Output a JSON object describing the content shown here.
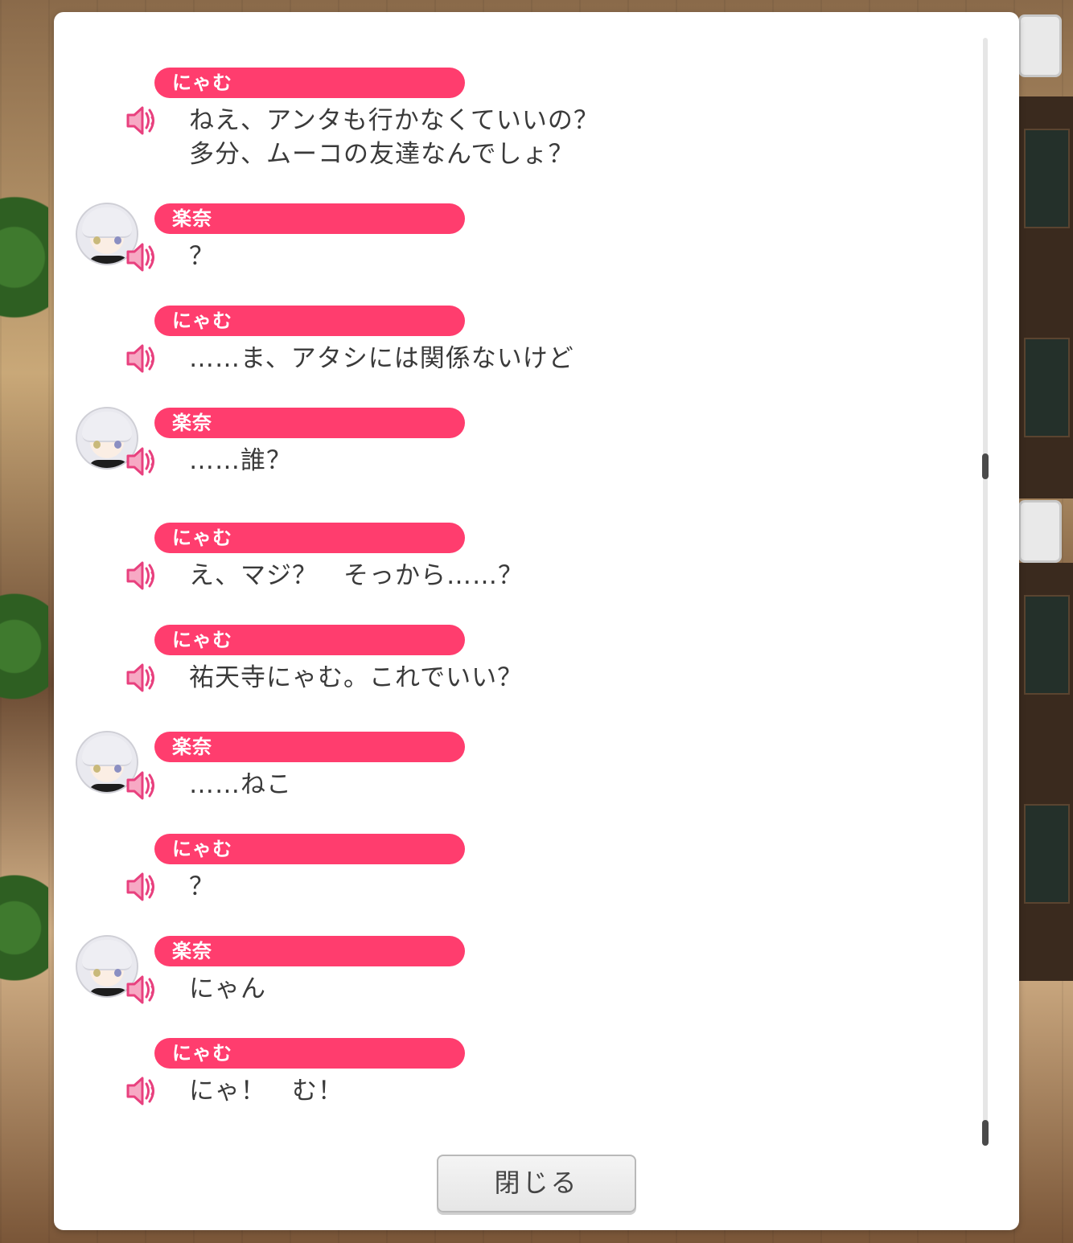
{
  "dialog": {
    "close_label": "閉じる"
  },
  "messages": [
    {
      "speaker": "にゃむ",
      "text": "ねえ、アンタも行かなくていいの？\n多分、ムーコの友達なんでしょ？",
      "avatar": false
    },
    {
      "speaker": "楽奈",
      "text": "？",
      "avatar": true
    },
    {
      "speaker": "にゃむ",
      "text": "……ま、アタシには関係ないけど",
      "avatar": false
    },
    {
      "speaker": "楽奈",
      "text": "……誰？",
      "avatar": true
    },
    {
      "speaker": "にゃむ",
      "text": "え、マジ？　そっから……？",
      "avatar": false
    },
    {
      "speaker": "にゃむ",
      "text": "祐天寺にゃむ。これでいい？",
      "avatar": false
    },
    {
      "speaker": "楽奈",
      "text": "……ねこ",
      "avatar": true
    },
    {
      "speaker": "にゃむ",
      "text": "？",
      "avatar": false
    },
    {
      "speaker": "楽奈",
      "text": "にゃん",
      "avatar": true
    },
    {
      "speaker": "にゃむ",
      "text": "にゃ！　む！",
      "avatar": false
    }
  ],
  "icons": {
    "voice": "speaker-icon",
    "avatar": "rana-avatar"
  },
  "colors": {
    "name_pill": "#ff3d6e",
    "speaker_icon": "#f0508a"
  }
}
